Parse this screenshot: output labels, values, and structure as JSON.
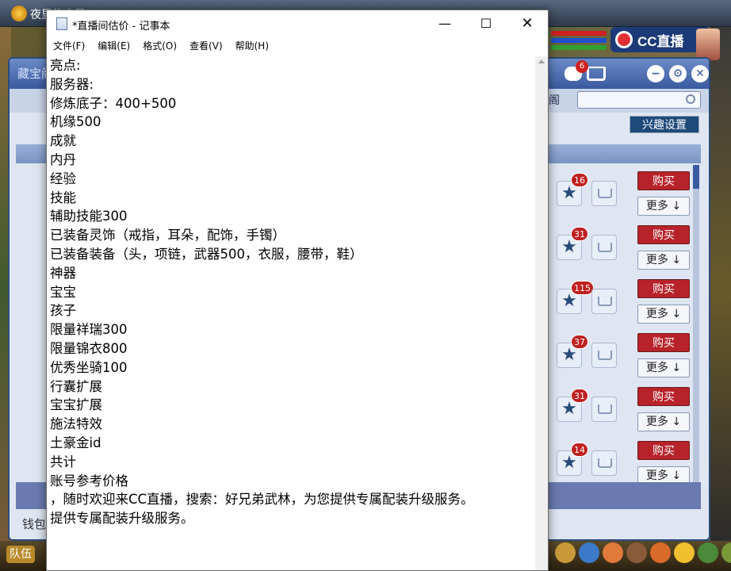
{
  "game": {
    "app_name": "夜里的大武",
    "panel_title": "藏宝阁",
    "pavilion_tab": "阁",
    "chat_badge": "6",
    "interest_button": "兴趣设置",
    "money_label": "钱包",
    "team_button": "队伍",
    "cc_logo": "CC直播",
    "items": [
      {
        "fav_count": "16",
        "buy": "购买",
        "more": "更多 ↓"
      },
      {
        "fav_count": "31",
        "buy": "购买",
        "more": "更多 ↓"
      },
      {
        "fav_count": "115",
        "buy": "购买",
        "more": "更多 ↓"
      },
      {
        "fav_count": "37",
        "buy": "购买",
        "more": "更多 ↓"
      },
      {
        "fav_count": "31",
        "buy": "购买",
        "more": "更多 ↓"
      },
      {
        "fav_count": "14",
        "buy": "购买",
        "more": "更多 ↓"
      }
    ]
  },
  "notepad": {
    "title": "*直播间估价 - 记事本",
    "controls": {
      "minimize": "—",
      "maximize": "☐",
      "close": "✕"
    },
    "menu": [
      "文件(F)",
      "编辑(E)",
      "格式(O)",
      "查看(V)",
      "帮助(H)"
    ],
    "lines": [
      "亮点:",
      "服务器:",
      "修炼底子：400+500",
      "机缘500",
      "成就",
      "内丹",
      "经验",
      "技能",
      "辅助技能300",
      "已装备灵饰（戒指，耳朵，配饰，手镯）",
      "已装备装备（头，项链，武器500，衣服，腰带，鞋）",
      "神器",
      "宝宝",
      "孩子",
      "限量祥瑞300",
      "限量锦衣800",
      "优秀坐骑100",
      "行囊扩展",
      "宝宝扩展",
      "施法特效",
      "土豪金id",
      "共计",
      "账号参考价格",
      "，随时欢迎来CC直播，搜索：好兄弟武林，为您提供专属配装升级服务。",
      "提供专属配装升级服务。"
    ]
  }
}
